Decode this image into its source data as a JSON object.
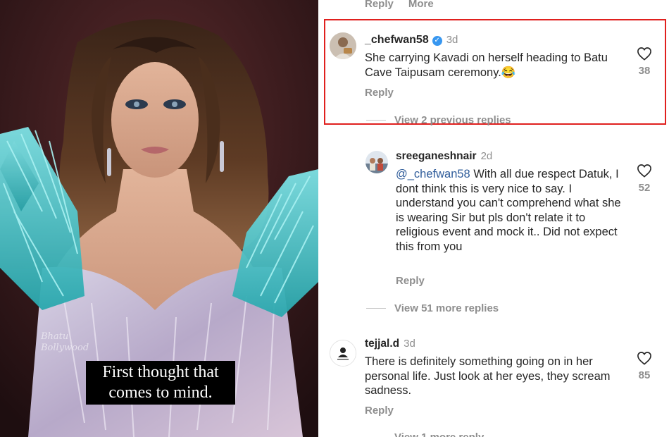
{
  "photo": {
    "watermark_line1": "Bhatu",
    "watermark_line2": "Bollywood",
    "caption_line1": "First thought that",
    "caption_line2": "comes to mind."
  },
  "top_actions": {
    "reply": "Reply",
    "more": "More"
  },
  "comments": [
    {
      "username": "_chefwan58",
      "verified": true,
      "time": "3d",
      "text": "She carrying Kavadi on herself heading to Batu Cave Taipusam ceremony.😂",
      "reply_label": "Reply",
      "likes": "38",
      "highlighted": true
    },
    {
      "view_replies": "View 2 previous replies"
    },
    {
      "username": "sreeganeshnair",
      "time": "2d",
      "mention": "@_chefwan58",
      "text": " With all due respect Datuk, I dont think this is very nice to say. I understand you can't comprehend what she is wearing Sir but pls don't relate it to religious event and mock it.. Did not expect this from you",
      "reply_label": "Reply",
      "likes": "52"
    },
    {
      "view_replies": "View 51 more replies"
    },
    {
      "username": "tejjal.d",
      "time": "3d",
      "text": "There is definitely something going on in her personal life. Just look at her eyes, they scream sadness.",
      "reply_label": "Reply",
      "likes": "85"
    },
    {
      "view_replies": "View 1 more reply"
    }
  ],
  "colors": {
    "highlight_border": "#e0201e",
    "verified_badge": "#3897f0",
    "mention": "#2f5c9a",
    "secondary_text": "#8e8e8e"
  }
}
